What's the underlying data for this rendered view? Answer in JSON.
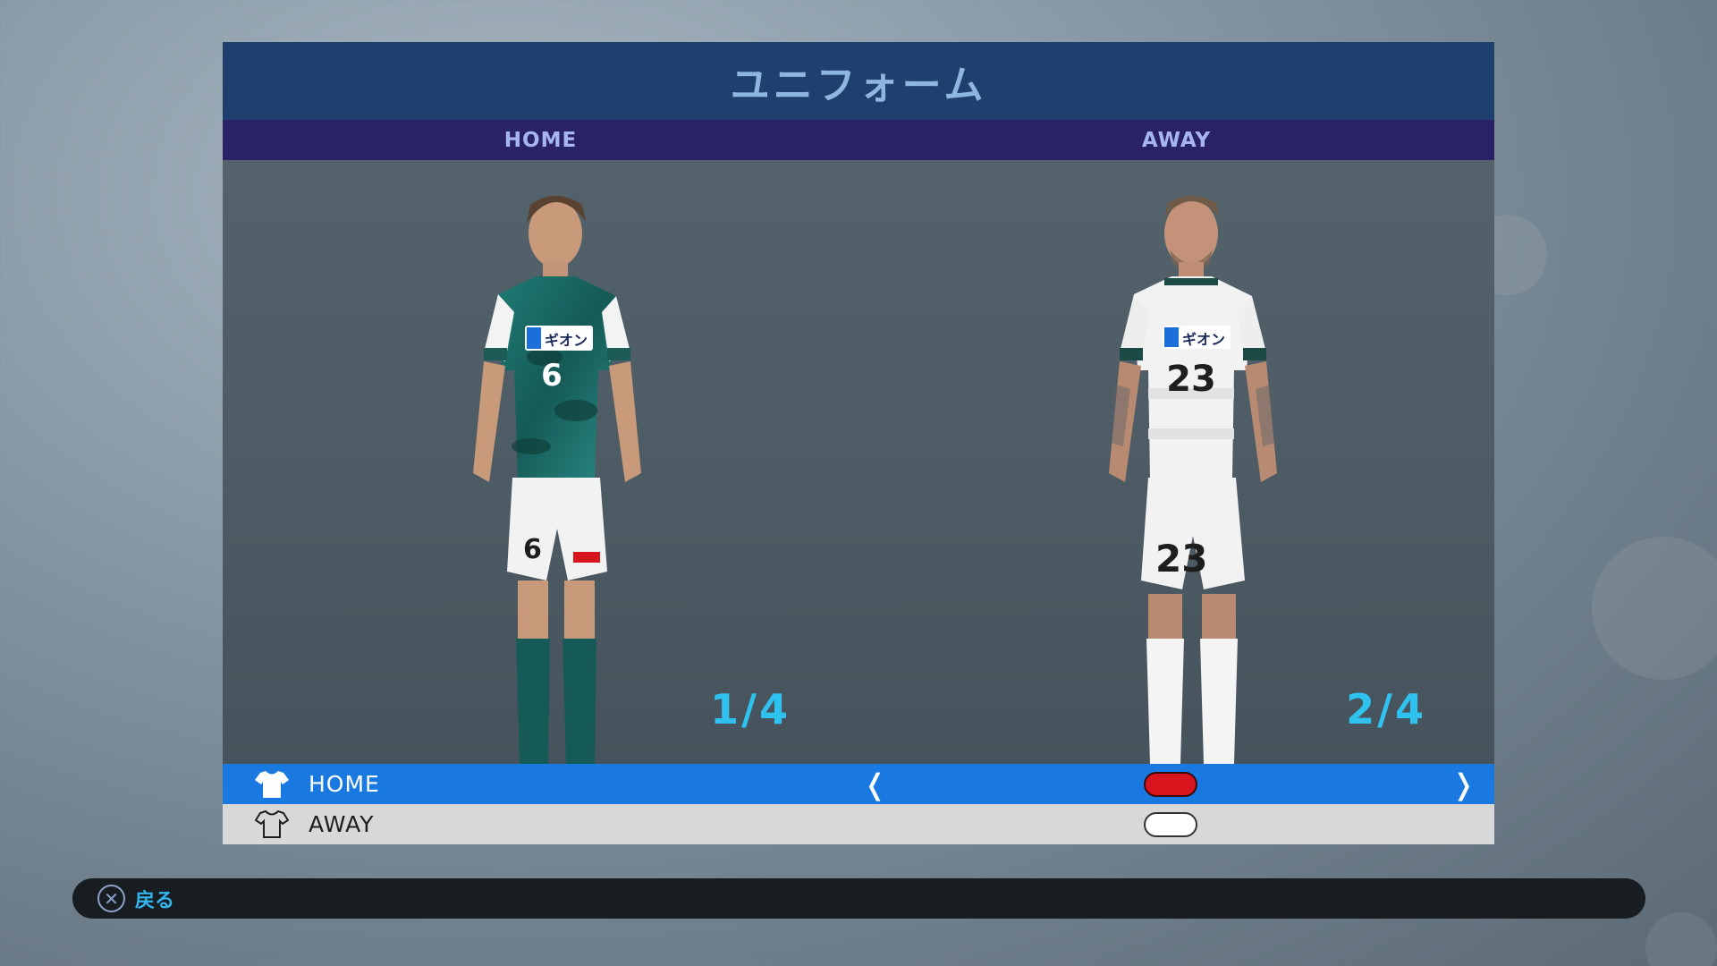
{
  "screen": {
    "title": "ユニフォーム",
    "tabs": [
      {
        "label": "HOME"
      },
      {
        "label": "AWAY"
      }
    ]
  },
  "kits": [
    {
      "slot": "HOME",
      "counter": "1/4",
      "shirt_number": "6",
      "sponsor": "ギオン"
    },
    {
      "slot": "AWAY",
      "counter": "2/4",
      "shirt_number": "23",
      "sponsor": "ギオン"
    }
  ],
  "options": [
    {
      "label": "HOME",
      "selected": true,
      "color_name": "red",
      "color": "#d8141c"
    },
    {
      "label": "AWAY",
      "selected": false,
      "color_name": "white",
      "color": "#ffffff"
    }
  ],
  "footer": {
    "button_icon": "cross-button-icon",
    "back_label": "戻る"
  },
  "colors": {
    "title_bg": "#1f3f6e",
    "tab_bg": "#2a2266",
    "selected_row": "#1a79e0",
    "counter": "#2fc2ee",
    "home_kit": "#1e6e6a",
    "away_kit": "#f2f2f2"
  }
}
